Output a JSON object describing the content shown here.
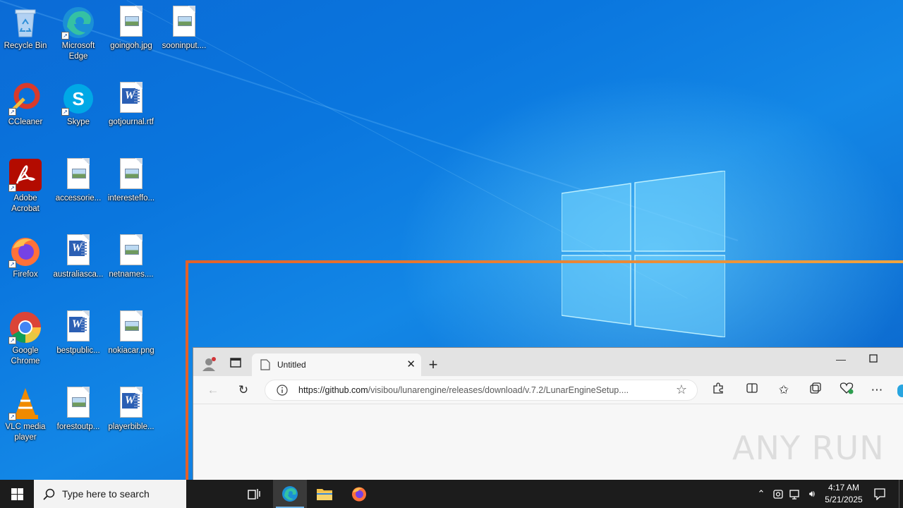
{
  "desktop": {
    "icons": [
      {
        "label": "Recycle Bin"
      },
      {
        "label": "Microsoft Edge"
      },
      {
        "label": "goingoh.jpg"
      },
      {
        "label": "sooninput...."
      },
      {
        "label": "CCleaner"
      },
      {
        "label": "Skype"
      },
      {
        "label": "gotjournal.rtf"
      },
      {
        "label": "Adobe Acrobat"
      },
      {
        "label": "accessorie..."
      },
      {
        "label": "interesteffo..."
      },
      {
        "label": "Firefox"
      },
      {
        "label": "australiasca..."
      },
      {
        "label": "netnames...."
      },
      {
        "label": "Google Chrome"
      },
      {
        "label": "bestpublic..."
      },
      {
        "label": "nokiacar.png"
      },
      {
        "label": "VLC media player"
      },
      {
        "label": "forestoutp..."
      },
      {
        "label": "playerbible..."
      }
    ]
  },
  "browser": {
    "tab_title": "Untitled",
    "url_host": "https://github.com",
    "url_path": "/visibou/lunarengine/releases/download/v.7.2/LunarEngineSetup...."
  },
  "watermark": "ANY RUN",
  "taskbar": {
    "search_placeholder": "Type here to search",
    "time": "4:17 AM",
    "date": "5/21/2025"
  },
  "colors": {
    "overlay": "#e2612a",
    "taskbar": "#1c1c1c",
    "accent": "#76b9ed"
  }
}
